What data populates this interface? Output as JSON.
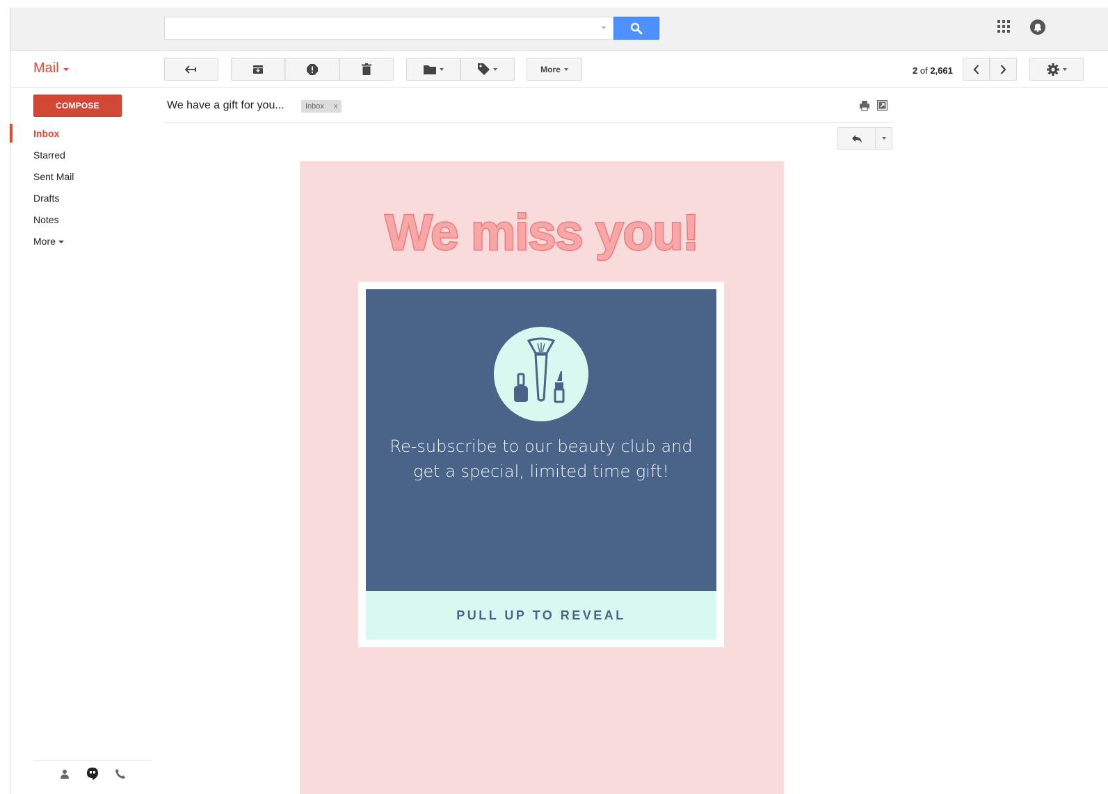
{
  "search": {
    "value": "",
    "placeholder": ""
  },
  "header": {
    "app_title": "Mail"
  },
  "toolbar": {
    "more_label": "More"
  },
  "pager": {
    "current": "2",
    "of_word": "of",
    "total": "2,661"
  },
  "sidebar": {
    "compose_label": "COMPOSE",
    "items": [
      {
        "label": "Inbox",
        "active": true
      },
      {
        "label": "Starred"
      },
      {
        "label": "Sent Mail"
      },
      {
        "label": "Drafts"
      },
      {
        "label": "Notes"
      },
      {
        "label": "More"
      }
    ]
  },
  "message": {
    "subject": "We have a gift for you...",
    "label": "Inbox",
    "label_remove": "x"
  },
  "email": {
    "headline": "We miss you!",
    "body_line1": "Re-subscribe to our beauty club and",
    "body_line2": "get a special, limited time gift!",
    "cta": "PULL UP TO REVEAL"
  },
  "colors": {
    "accent_red": "#dd4b39",
    "search_blue": "#4d90fe",
    "email_bg": "#fadbdb",
    "card_blue": "#4a6388",
    "mint": "#d9f8ef",
    "headline_pink": "#f7a7a7"
  },
  "icons": [
    "search-icon",
    "apps-grid-icon",
    "notifications-icon",
    "back-arrow-icon",
    "archive-icon",
    "report-spam-icon",
    "delete-icon",
    "folder-icon",
    "label-tag-icon",
    "chevron-left-icon",
    "chevron-right-icon",
    "gear-icon",
    "print-icon",
    "new-window-icon",
    "reply-icon",
    "contacts-icon",
    "hangouts-icon",
    "phone-icon",
    "makeup-brush-icon",
    "nail-polish-icon",
    "lipstick-icon"
  ]
}
